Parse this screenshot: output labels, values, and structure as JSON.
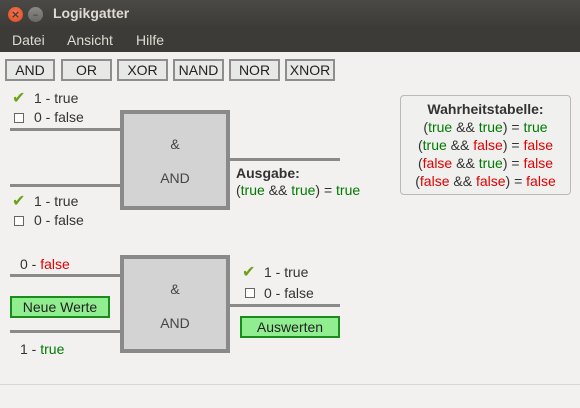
{
  "window": {
    "title": "Logikgatter"
  },
  "menu": [
    "Datei",
    "Ansicht",
    "Hilfe"
  ],
  "gate_buttons": [
    "AND",
    "OR",
    "XOR",
    "NAND",
    "NOR",
    "XNOR"
  ],
  "circuit1": {
    "input_a": {
      "checked_label": "1 - true",
      "unchecked_label": "0 - false",
      "checked": true
    },
    "input_b": {
      "checked_label": "1 - true",
      "unchecked_label": "0 - false",
      "checked": true
    },
    "gate_symbol": "&",
    "gate_name": "AND",
    "output_title": "Ausgabe:",
    "output_expr": {
      "open": "(",
      "a": "true",
      "op": " && ",
      "b": "true",
      "mid": ") = ",
      "result": "true"
    }
  },
  "truth_table": {
    "title": "Wahrheitstabelle:",
    "rows": [
      {
        "a": "true",
        "b": "true",
        "result": "true",
        "op": " && "
      },
      {
        "a": "true",
        "b": "false",
        "result": "false",
        "op": " && "
      },
      {
        "a": "false",
        "b": "true",
        "result": "false",
        "op": " && "
      },
      {
        "a": "false",
        "b": "false",
        "result": "false",
        "op": " && "
      }
    ]
  },
  "circuit2": {
    "input_a": {
      "prefix": "0 - ",
      "value": "false"
    },
    "input_b": {
      "prefix": "1 - ",
      "value": "true"
    },
    "gate_symbol": "&",
    "gate_name": "AND",
    "new_values_button": "Neue Werte",
    "output_checked_label": "1 - true",
    "output_unchecked_label": "0 - false",
    "evaluate_button": "Auswerten"
  },
  "colors": {
    "true": "#007a00",
    "false": "#e00000",
    "button_green": "#90ee90"
  },
  "icons": [
    "close-icon",
    "minimize-icon",
    "checkmark-icon",
    "checkbox-icon"
  ]
}
